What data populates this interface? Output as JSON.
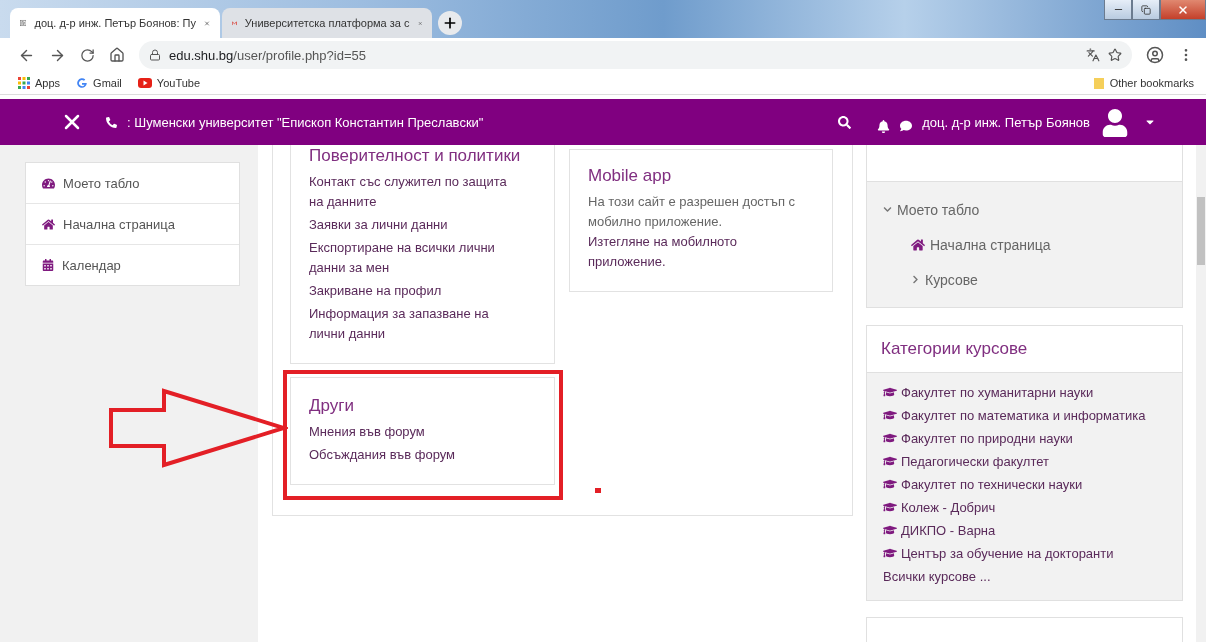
{
  "browser": {
    "tabs": [
      {
        "title": "доц. д-р инж. Петър Боянов: Пу",
        "kind": "page",
        "selected": true
      },
      {
        "title": "Университетска платформа за с",
        "kind": "mail",
        "selected": false
      }
    ],
    "url_host": "edu.shu.bg",
    "url_path": "/user/profile.php?id=55",
    "bookmarks": [
      {
        "label": "Apps",
        "kind": "apps"
      },
      {
        "label": "Gmail",
        "kind": "google"
      },
      {
        "label": "YouTube",
        "kind": "youtube"
      }
    ],
    "other_bookmarks": "Other bookmarks"
  },
  "navbar": {
    "site_name": ": Шуменски университет \"Епископ Константин Преславски\"",
    "user_name": "доц. д-р инж. Петър Боянов"
  },
  "left_menu": [
    {
      "label": "Моето табло",
      "kind": "dashboard"
    },
    {
      "label": "Начална страница",
      "kind": "home"
    },
    {
      "label": "Календар",
      "kind": "calendar"
    }
  ],
  "privacy_card": {
    "title": "Поверителност и политики",
    "links": [
      "Контакт със служител по защита на данните",
      "Заявки за лични данни",
      "Експортиране на всички лични данни за мен",
      "Закриване на профил",
      "Информация за запазване на лични данни"
    ]
  },
  "mobile_card": {
    "title": "Mobile app",
    "text": "На този сайт е разрешен достъп с мобилно приложение.",
    "link": "Изтегляне на мобилното приложение."
  },
  "other_card": {
    "title": "Други",
    "links": [
      "Мнения във форум",
      "Обсъждания във форум"
    ]
  },
  "navigation": {
    "tree": [
      {
        "label": "Моето табло",
        "kind": "branch",
        "expanded": true,
        "children": [
          {
            "label": "Начална страница",
            "kind": "home"
          },
          {
            "label": "Курсове",
            "kind": "branch",
            "expanded": false
          }
        ]
      }
    ]
  },
  "categories": {
    "title": "Категории курсове",
    "items": [
      "Факултет по хуманитарни науки",
      "Факултет по математика и информатика",
      "Факултет по природни науки",
      "Педагогически факултет",
      "Факултет по технически науки",
      "Колеж - Добрич",
      "ДИКПО - Варна",
      "Център за обучение на докторанти"
    ],
    "all_link": "Всички курсове ..."
  }
}
